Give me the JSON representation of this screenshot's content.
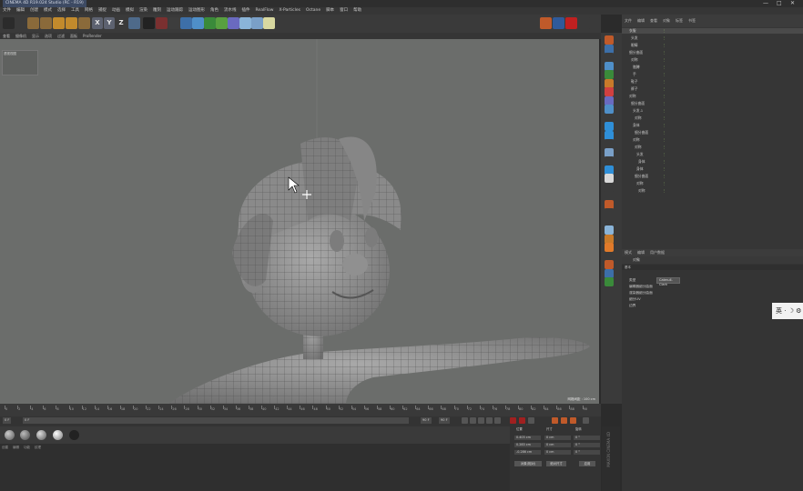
{
  "window": {
    "title": "CINEMA 4D R19.024 Studio (RC - R19)",
    "minimize": "—",
    "maximize": "□",
    "close": "✕"
  },
  "menu": [
    "文件",
    "编辑",
    "创建",
    "模式",
    "选择",
    "工具",
    "网格",
    "捕捉",
    "动画",
    "模拟",
    "渲染",
    "雕刻",
    "运动跟踪",
    "运动图形",
    "角色",
    "流水线",
    "插件",
    "RealFlow",
    "X-Particles",
    "Octane",
    "脚本",
    "窗口",
    "帮助"
  ],
  "toolbar": {
    "axis_x": "X",
    "axis_y": "Y",
    "axis_z": "Z"
  },
  "viewport": {
    "menu": [
      "查看",
      "摄像机",
      "显示",
      "选项",
      "过滤",
      "面板",
      "ProRender"
    ],
    "camera_label": "透视视图",
    "grid_spacing": "网格间距 : 100 cm"
  },
  "objects": {
    "tabs": [
      "文件",
      "编辑",
      "查看",
      "对象",
      "标签",
      "书签"
    ],
    "rows": [
      "衣服",
      "头发",
      "眼睛",
      "细分曲面",
      "对称",
      "胳膊",
      "手",
      "鞋子",
      "裤子",
      "对称",
      "细分曲面",
      "头发.1",
      "对称",
      "身体",
      "细分曲面",
      "对称",
      "对称",
      "头发",
      "身体",
      "身体",
      "细分曲面",
      "对称",
      "对称"
    ]
  },
  "attributes": {
    "tabs": [
      "模式",
      "编辑",
      "用户数据"
    ],
    "object_label": "对象",
    "section": "基本",
    "row_labels": [
      "类型",
      "编辑器细分曲面",
      "渲染器细分曲面",
      "细分UV",
      "边界"
    ],
    "type_value": "Catmull-Clark"
  },
  "popup": {
    "text": "英 · ☽ ⚙"
  },
  "timeline": {
    "frames": [
      "0",
      "2",
      "4",
      "6",
      "8",
      "10",
      "12",
      "14",
      "16",
      "18",
      "20",
      "22",
      "24",
      "26",
      "28",
      "30",
      "32",
      "34",
      "36",
      "38",
      "40",
      "42",
      "44",
      "46",
      "48",
      "50",
      "52",
      "54",
      "56",
      "58",
      "60",
      "62",
      "64",
      "66",
      "68",
      "70",
      "72",
      "74",
      "76",
      "78",
      "80",
      "82",
      "84",
      "86",
      "88",
      "90"
    ],
    "start_field": "0 F",
    "current_field": "0 F",
    "end_field": "90 F",
    "end_field2": "90 F",
    "frame_end_label": "0 F"
  },
  "coords": {
    "headers": [
      "位置",
      "尺寸",
      "旋转"
    ],
    "x_pos": "0.403 cm",
    "y_pos": "0.283 cm",
    "z_pos": "-0.286 cm",
    "x_size": "0 cm",
    "y_size": "0 cm",
    "z_size": "0 cm",
    "h_rot": "0 °",
    "p_rot": "0 °",
    "b_rot": "0 °",
    "mode_btn": "对象(相对)",
    "size_btn": "绝对尺寸",
    "apply_btn": "应用"
  },
  "brand": "MAXON CINEMA 4D",
  "materials": {
    "menu": [
      "创建",
      "编辑",
      "功能",
      "纹理"
    ]
  }
}
